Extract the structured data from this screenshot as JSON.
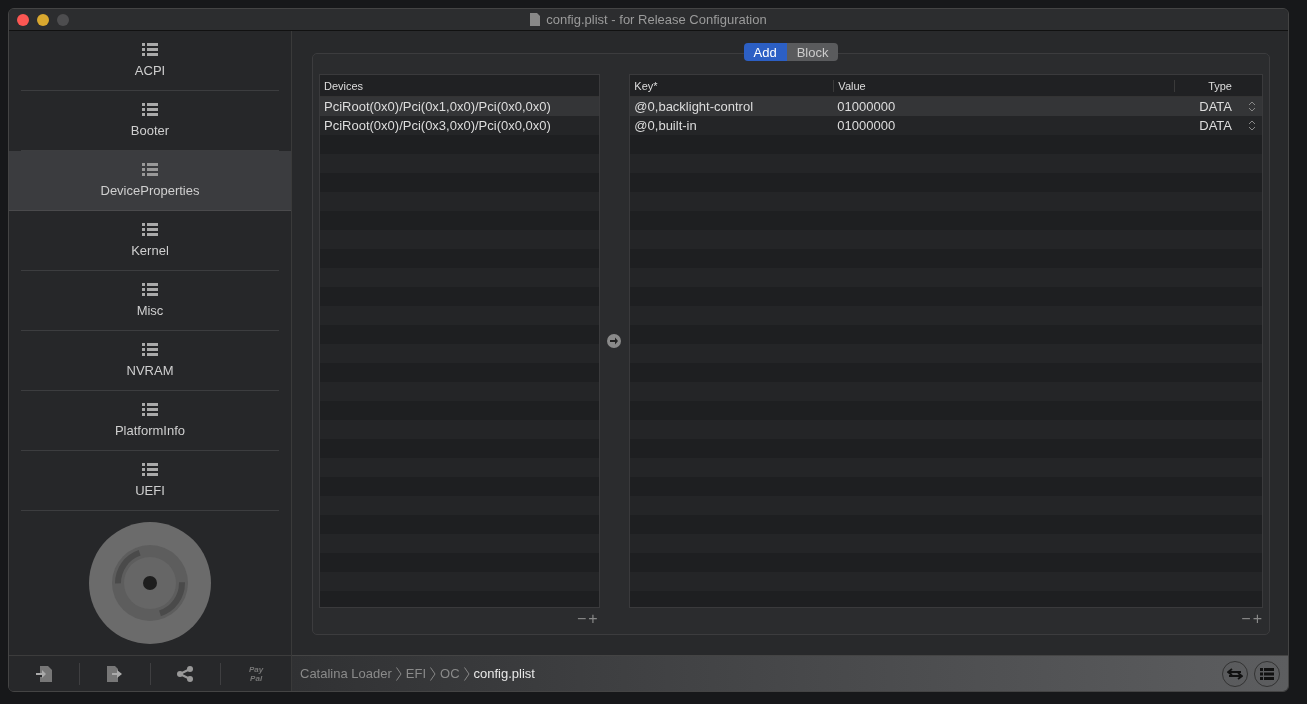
{
  "window": {
    "title": "config.plist - for Release Configuration"
  },
  "sidebar": {
    "items": [
      {
        "label": "ACPI",
        "selected": false
      },
      {
        "label": "Booter",
        "selected": false
      },
      {
        "label": "DeviceProperties",
        "selected": true
      },
      {
        "label": "Kernel",
        "selected": false
      },
      {
        "label": "Misc",
        "selected": false
      },
      {
        "label": "NVRAM",
        "selected": false
      },
      {
        "label": "PlatformInfo",
        "selected": false
      },
      {
        "label": "UEFI",
        "selected": false
      }
    ],
    "paypal_label": [
      "Pay",
      "Pal"
    ]
  },
  "segments": [
    {
      "label": "Add",
      "selected": true
    },
    {
      "label": "Block",
      "selected": false
    }
  ],
  "devices_table": {
    "columns": [
      "Devices"
    ],
    "rows": [
      {
        "path": "PciRoot(0x0)/Pci(0x1,0x0)/Pci(0x0,0x0)",
        "selected": true
      },
      {
        "path": "PciRoot(0x0)/Pci(0x3,0x0)/Pci(0x0,0x0)",
        "selected": false
      }
    ],
    "remove": "−",
    "add": "+"
  },
  "properties_table": {
    "columns": [
      "Key*",
      "Value",
      "Type"
    ],
    "rows": [
      {
        "key": "@0,backlight-control",
        "value": "01000000",
        "type": "DATA",
        "selected": true
      },
      {
        "key": "@0,built-in",
        "value": "01000000",
        "type": "DATA",
        "selected": false
      }
    ],
    "remove": "−",
    "add": "+"
  },
  "path_bar": {
    "items": [
      {
        "label": "Catalina Loader",
        "current": false
      },
      {
        "label": "EFI",
        "current": false
      },
      {
        "label": "OC",
        "current": false
      },
      {
        "label": "config.plist",
        "current": true
      }
    ]
  }
}
